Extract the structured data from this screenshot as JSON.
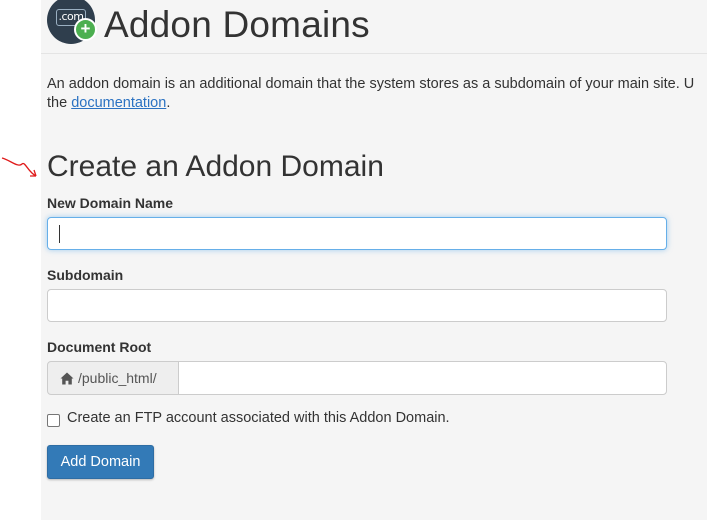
{
  "header": {
    "title": "Addon Domains",
    "logo_text": ".com",
    "logo_plus": "+"
  },
  "intro": {
    "text": "An addon domain is an additional domain that the system stores as a subdomain of your main site. U",
    "line2_prefix": "the ",
    "link_text": "documentation",
    "line2_suffix": "."
  },
  "form": {
    "section_title": "Create an Addon Domain",
    "new_domain_label": "New Domain Name",
    "new_domain_value": "",
    "subdomain_label": "Subdomain",
    "subdomain_value": "",
    "document_root_label": "Document Root",
    "document_root_prefix": "/public_html/",
    "document_root_value": "",
    "ftp_checkbox_label": "Create an FTP account associated with this Addon Domain.",
    "ftp_checked": false,
    "submit_label": "Add Domain"
  },
  "colors": {
    "accent": "#337ab7",
    "link": "#2b72c2",
    "focus": "#66afe9",
    "annotation": "#e01b1b"
  },
  "icons": {
    "logo": "addon-domain-icon",
    "home": "home-icon",
    "annotation": "red-arrow-annotation"
  }
}
